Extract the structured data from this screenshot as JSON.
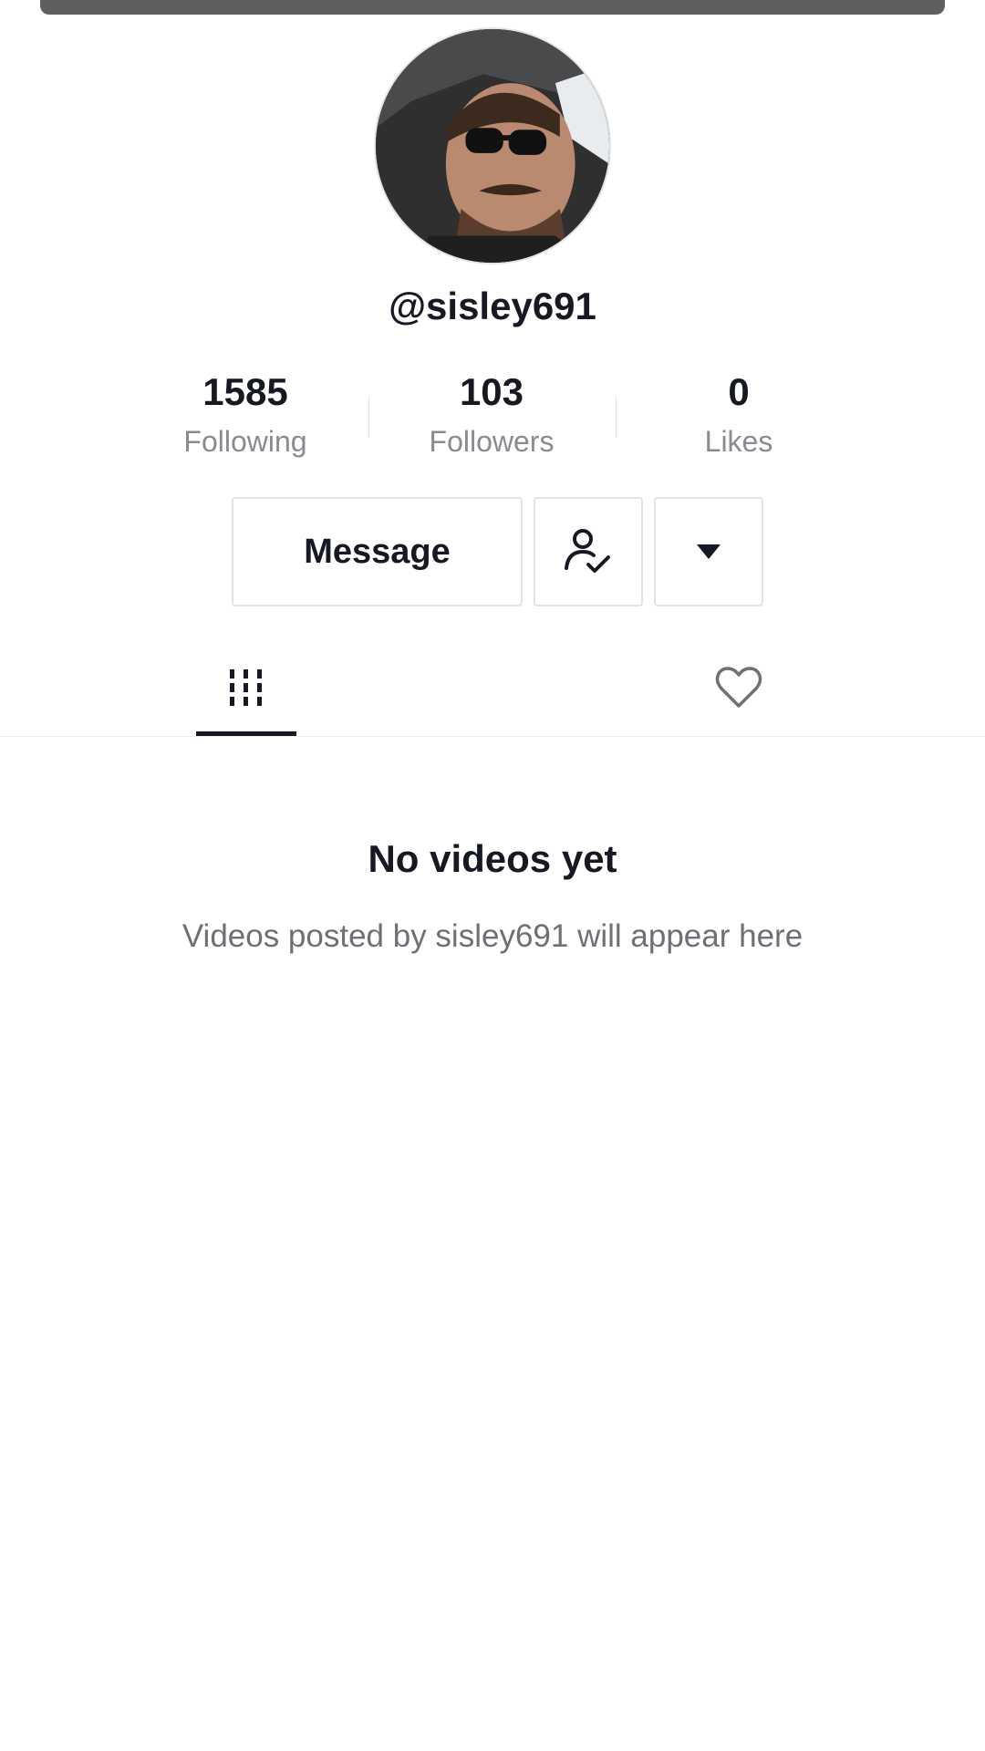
{
  "profile": {
    "username": "@sisley691",
    "avatar_alt": "profile photo"
  },
  "stats": {
    "following": {
      "value": "1585",
      "label": "Following"
    },
    "followers": {
      "value": "103",
      "label": "Followers"
    },
    "likes": {
      "value": "0",
      "label": "Likes"
    }
  },
  "actions": {
    "message_label": "Message",
    "following_icon": "person-check-icon",
    "more_icon": "caret-down-icon"
  },
  "tabs": [
    {
      "name": "videos",
      "icon": "grid-icon",
      "active": true
    },
    {
      "name": "liked",
      "icon": "heart-outline-icon",
      "active": false
    }
  ],
  "empty_state": {
    "title": "No videos yet",
    "subtitle": "Videos posted by sisley691 will appear here"
  },
  "colors": {
    "text_primary": "#161823",
    "text_secondary": "#8a8b91",
    "border": "#e3e3e4",
    "top_bar": "#5e5e5e"
  }
}
